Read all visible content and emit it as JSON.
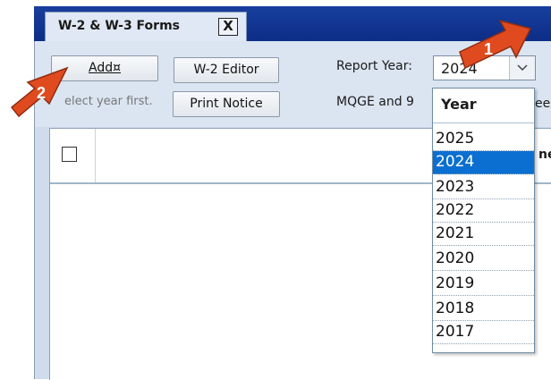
{
  "tab": {
    "title": "W-2 & W-3 Forms",
    "close_label": "X"
  },
  "toolbar": {
    "add_label": "Add¤",
    "w2_editor_label": "W-2 Editor",
    "print_notice_label": "Print Notice",
    "hint_text": "elect year first.",
    "report_year_label": "Report Year:",
    "report_year_value": "2024",
    "mqge_text": "MQGE and 9",
    "partial_text": "ee"
  },
  "grid": {
    "partial_column_header": "ne"
  },
  "dropdown": {
    "header": "Year",
    "selected": "2024",
    "options": [
      "2025",
      "2024",
      "2023",
      "2022",
      "2021",
      "2020",
      "2019",
      "2018",
      "2017"
    ]
  },
  "annotations": {
    "marker_1": "1",
    "marker_2": "2"
  },
  "colors": {
    "tab_strip": "#0d2d86",
    "selection": "#0a6fd0",
    "annotation_arrow": "#e04a1f"
  }
}
